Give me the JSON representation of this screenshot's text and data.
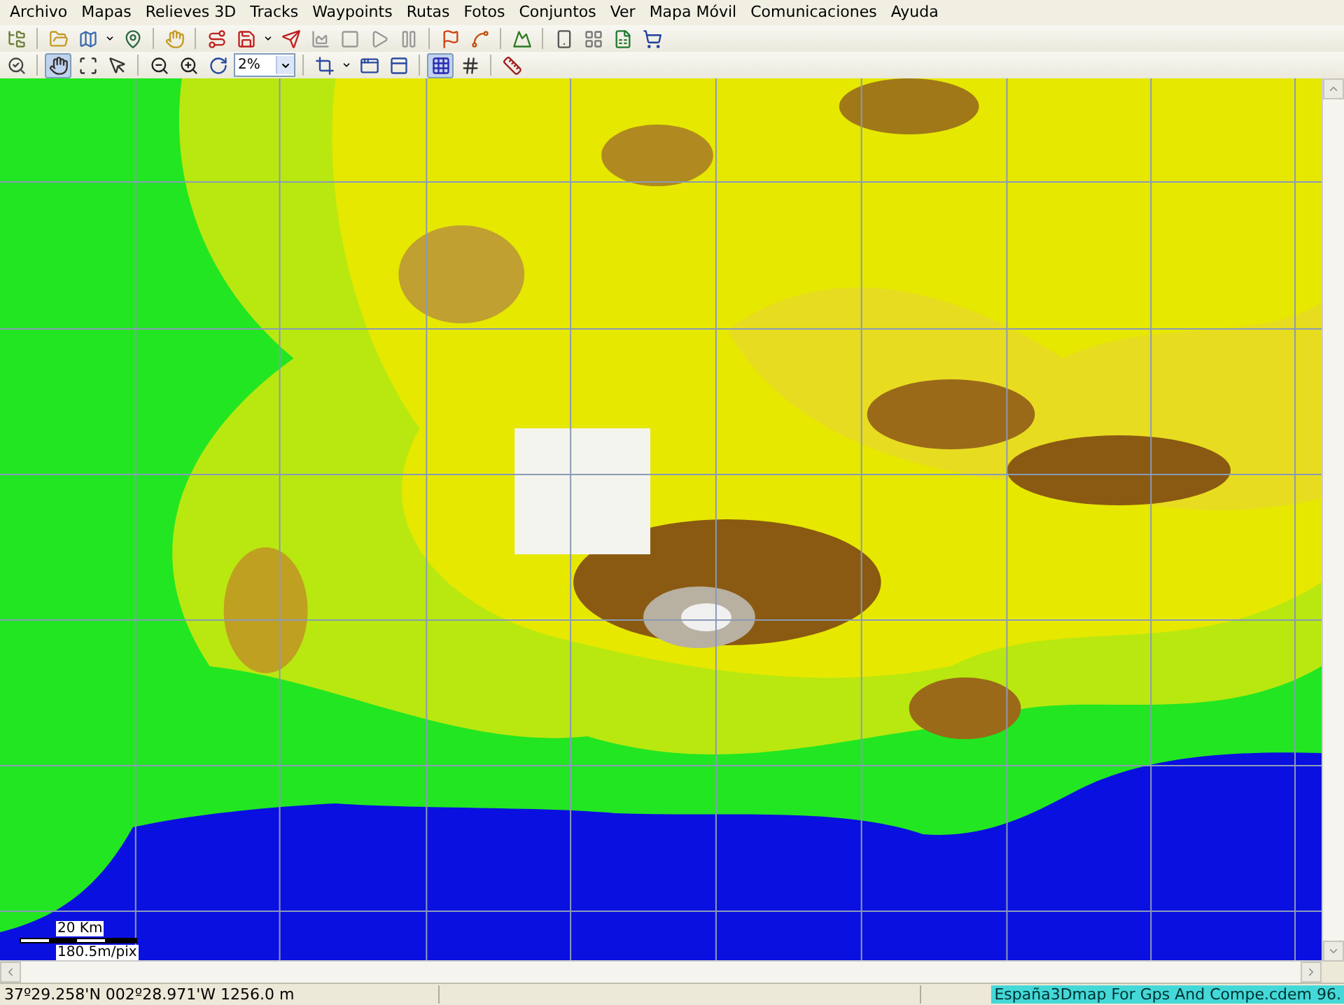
{
  "menu": [
    {
      "label": "Archivo"
    },
    {
      "label": "Mapas"
    },
    {
      "label": "Relieves 3D"
    },
    {
      "label": "Tracks"
    },
    {
      "label": "Waypoints"
    },
    {
      "label": "Rutas"
    },
    {
      "label": "Fotos"
    },
    {
      "label": "Conjuntos"
    },
    {
      "label": "Ver"
    },
    {
      "label": "Mapa Móvil"
    },
    {
      "label": "Comunicaciones"
    },
    {
      "label": "Ayuda"
    }
  ],
  "toolbar_rows": [
    {
      "items": [
        {
          "kind": "button",
          "pressed": false
        },
        {
          "kind": "separator"
        },
        {
          "kind": "button",
          "pressed": false
        },
        {
          "kind": "button",
          "pressed": false
        },
        {
          "kind": "dropdown"
        },
        {
          "kind": "button",
          "pressed": false
        },
        {
          "kind": "separator"
        },
        {
          "kind": "button",
          "pressed": false
        },
        {
          "kind": "separator"
        },
        {
          "kind": "button",
          "pressed": false
        },
        {
          "kind": "button",
          "pressed": false
        },
        {
          "kind": "dropdown"
        },
        {
          "kind": "button",
          "pressed": false
        },
        {
          "kind": "button",
          "pressed": false
        },
        {
          "kind": "button",
          "pressed": false
        },
        {
          "kind": "button",
          "pressed": false
        },
        {
          "kind": "button",
          "pressed": false
        },
        {
          "kind": "separator"
        },
        {
          "kind": "button",
          "pressed": false
        },
        {
          "kind": "button",
          "pressed": false
        },
        {
          "kind": "separator"
        },
        {
          "kind": "button",
          "pressed": false
        },
        {
          "kind": "separator"
        },
        {
          "kind": "button",
          "pressed": false
        },
        {
          "kind": "button",
          "pressed": false
        },
        {
          "kind": "button",
          "pressed": false
        },
        {
          "kind": "button",
          "pressed": false
        }
      ]
    },
    {
      "items": [
        {
          "kind": "button",
          "pressed": false
        },
        {
          "kind": "separator"
        },
        {
          "kind": "button",
          "pressed": true
        },
        {
          "kind": "button",
          "pressed": false
        },
        {
          "kind": "button",
          "pressed": false
        },
        {
          "kind": "separator"
        },
        {
          "kind": "button",
          "pressed": false
        },
        {
          "kind": "button",
          "pressed": false
        },
        {
          "kind": "button",
          "pressed": false
        },
        {
          "kind": "combo",
          "value": "2%"
        },
        {
          "kind": "separator"
        },
        {
          "kind": "button",
          "pressed": false
        },
        {
          "kind": "dropdown"
        },
        {
          "kind": "button",
          "pressed": false
        },
        {
          "kind": "button",
          "pressed": false
        },
        {
          "kind": "separator"
        },
        {
          "kind": "button",
          "pressed": true
        },
        {
          "kind": "button",
          "pressed": false
        },
        {
          "kind": "separator"
        },
        {
          "kind": "button",
          "pressed": false
        }
      ]
    }
  ],
  "scale": {
    "distance": "20 Km",
    "resolution": "180.5m/pix"
  },
  "status_bar": {
    "position": "37º29.258'N 002º28.971'W  1256.0 m",
    "file": "España3Dmap For Gps And Compe.cdem  96."
  }
}
